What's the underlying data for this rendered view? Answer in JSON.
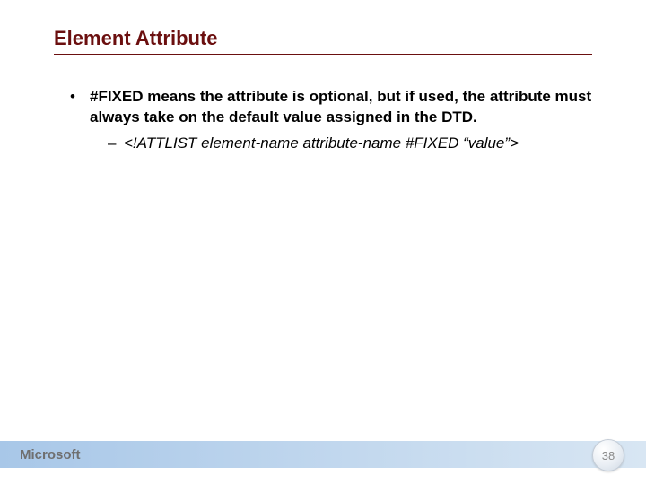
{
  "title": "Element Attribute",
  "bullet1_bold": "#FIXED means the attribute is optional, but if used, the attribute must always take on the default value assigned in the DTD.",
  "sub1": "<!ATTLIST element-name attribute-name #FIXED “value”>",
  "footer_logo": "Microsoft",
  "page_number": "38"
}
